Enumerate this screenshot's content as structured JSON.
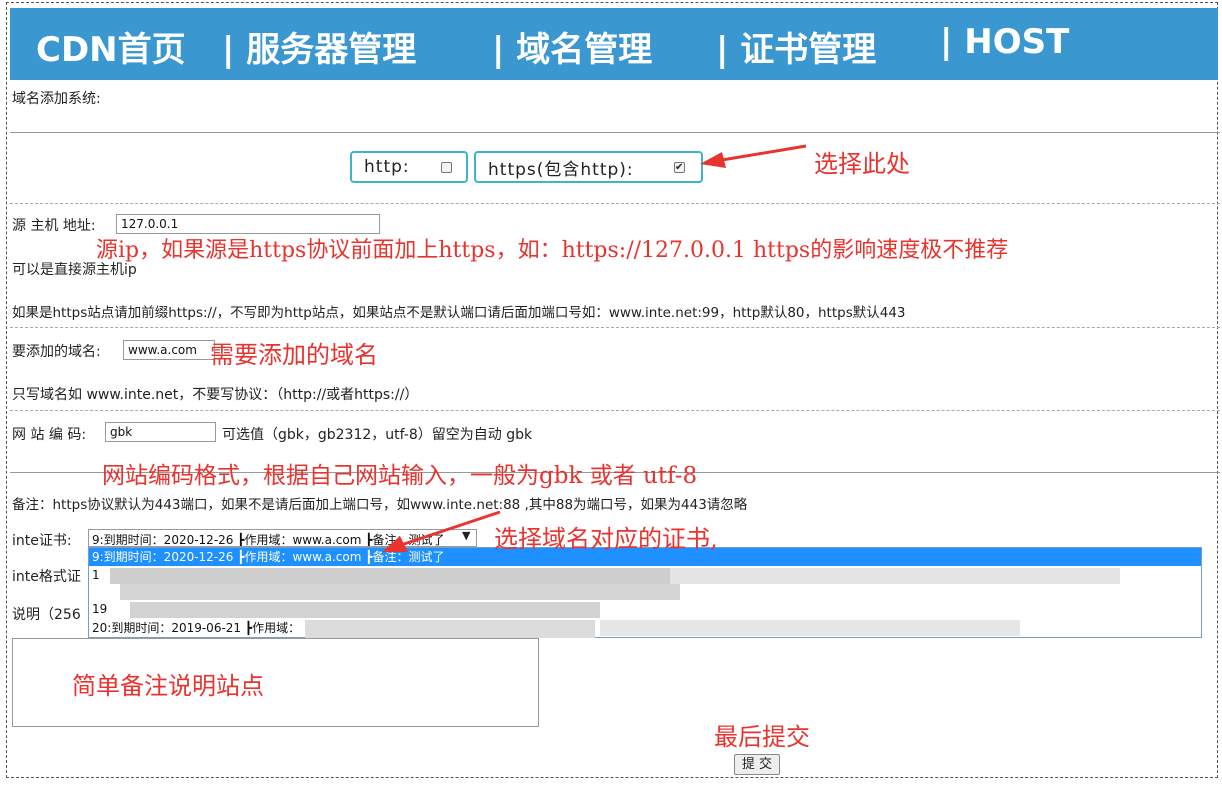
{
  "nav": {
    "items": [
      "CDN首页",
      "| 服务器管理",
      "| 域名管理",
      "| 证书管理",
      "| HOST"
    ],
    "bg": "#3a97d0"
  },
  "form": {
    "title": "域名添加系统:",
    "http_label": "http:",
    "http_checked": false,
    "https_label": "https(包含http):",
    "https_checked": true,
    "source_label": "源 主机 地址:",
    "source_value": "127.0.0.1",
    "source_hint1": "可以是直接源主机ip",
    "source_hint2": "如果是https站点请加前缀https://，不写即为http站点，如果站点不是默认端口请后面加端口号如：www.inte.net:99，http默认80，https默认443",
    "domain_label": "要添加的域名:",
    "domain_value": "www.a.com",
    "domain_hint": "只写域名如 www.inte.net，不要写协议：（http://或者https://）",
    "encoding_label": "网 站 编 码:",
    "encoding_value": "gbk",
    "encoding_hint": "可选值（gbk，gb2312，utf-8）留空为自动 gbk",
    "note": "备注：https协议默认为443端口，如果不是请后面加上端口号，如www.inte.net:88 ,其中88为端口号，如果为443请忽略",
    "cert_label": "inte证书:",
    "cert_selected": "9:到期时间：2020-12-26 ┣作用域：www.a.com ┣备注：测试了",
    "cert_options": [
      "9:到期时间：2020-12-26 ┣作用域：www.a.com ┣备注：测试了",
      "1",
      "19",
      "20:到期时间：2019-06-21 ┣作用域："
    ],
    "format_label": "inte格式证",
    "desc_label": "说明（256",
    "submit_label": "提 交"
  },
  "annotations": {
    "select_here": "选择此处",
    "source_ip": "源ip，如果源是https协议前面加上https，如：https://127.0.0.1 https的影响速度极不推荐",
    "domain_needed": "需要添加的域名",
    "encoding_note": "网站编码格式，根据自己网站输入，一般为gbk 或者 utf-8",
    "cert_note": "选择域名对应的证书,",
    "desc_note": "简单备注说明站点",
    "submit_note": "最后提交",
    "color": "#e8332e"
  }
}
